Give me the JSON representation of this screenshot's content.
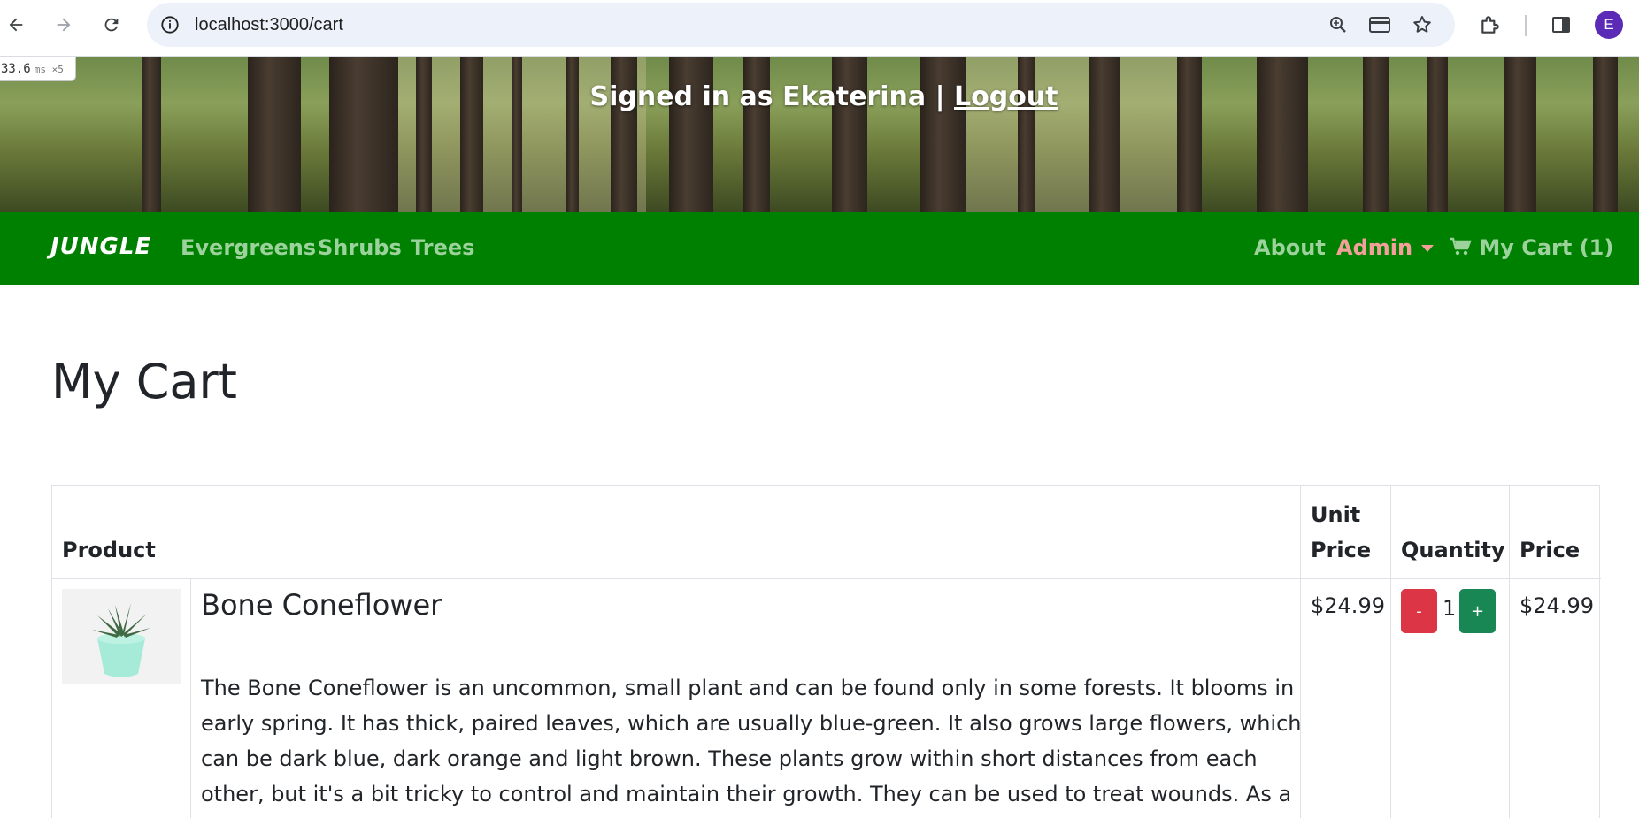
{
  "browser": {
    "url": "localhost:3000/cart",
    "avatar_letter": "E",
    "timer_value": "33.6",
    "timer_unit": "ms ×5"
  },
  "header": {
    "signed_in_text": "Signed in as Ekaterina | ",
    "logout_label": "Logout"
  },
  "nav": {
    "brand": "JUNGLE",
    "links": [
      "Evergreens",
      "Shrubs",
      "Trees"
    ],
    "about": "About",
    "admin": "Admin",
    "cart": "My Cart (1)"
  },
  "page": {
    "title": "My Cart"
  },
  "table": {
    "headers": {
      "product": "Product",
      "unit_price_line1": "Unit",
      "unit_price_line2": "Price",
      "quantity": "Quantity",
      "price": "Price"
    },
    "rows": [
      {
        "name": "Bone Coneflower",
        "description": "The Bone Coneflower is an uncommon, small plant and can be found only in some forests. It blooms in early spring. It has thick, paired leaves, which are usually blue-green. It also grows large flowers, which can be dark blue, dark orange and light brown. These plants grow within short distances from each other, but it's a bit tricky to control and maintain their growth. They can be used to treat wounds. As a defense mechanism the",
        "unit_price": "$24.99",
        "quantity": "1",
        "minus_label": "-",
        "plus_label": "+",
        "price": "$24.99"
      }
    ]
  },
  "colors": {
    "nav_green": "#008000",
    "nav_link": "#9cd29c",
    "admin_link": "#f4a09a",
    "minus_button": "#dc3545",
    "plus_button": "#198754"
  }
}
